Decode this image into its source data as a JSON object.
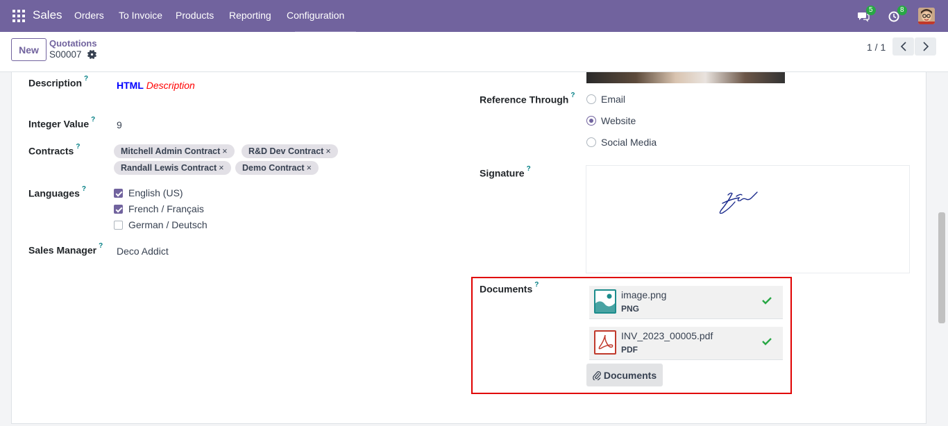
{
  "navbar": {
    "brand": "Sales",
    "menu": [
      "Orders",
      "To Invoice",
      "Products",
      "Reporting",
      "Configuration"
    ],
    "messages_count": "5",
    "activities_count": "8"
  },
  "control_panel": {
    "new_label": "New",
    "breadcrumb_parent": "Quotations",
    "breadcrumb_current": "S00007",
    "pager": "1 / 1"
  },
  "form": {
    "description": {
      "label": "Description",
      "help": "?",
      "html_bold": "HTML",
      "html_italic": "Description"
    },
    "integer_value": {
      "label": "Integer Value",
      "help": "?",
      "value": "9"
    },
    "contracts": {
      "label": "Contracts",
      "help": "?",
      "tags": [
        "Mitchell Admin Contract",
        "R&D Dev Contract",
        "Randall Lewis Contract",
        "Demo Contract"
      ],
      "remove_glyph": "×"
    },
    "languages": {
      "label": "Languages",
      "help": "?",
      "options": [
        {
          "label": "English (US)",
          "checked": true
        },
        {
          "label": "French / Français",
          "checked": true
        },
        {
          "label": "German / Deutsch",
          "checked": false
        }
      ]
    },
    "sales_manager": {
      "label": "Sales Manager",
      "help": "?",
      "value": "Deco Addict"
    },
    "reference_through": {
      "label": "Reference Through",
      "help": "?",
      "options": [
        "Email",
        "Website",
        "Social Media"
      ],
      "selected": "Website"
    },
    "signature": {
      "label": "Signature",
      "help": "?"
    },
    "documents": {
      "label": "Documents",
      "help": "?",
      "files": [
        {
          "name": "image.png",
          "type": "PNG",
          "icon": "image-file-icon",
          "color": "#1c8c8c"
        },
        {
          "name": "INV_2023_00005.pdf",
          "type": "PDF",
          "icon": "pdf-file-icon",
          "color": "#c0392b"
        }
      ],
      "button_label": "Documents"
    }
  },
  "colors": {
    "brand": "#71639e",
    "help": "#017e84",
    "success": "#28a745",
    "highlight": "#e00000"
  }
}
